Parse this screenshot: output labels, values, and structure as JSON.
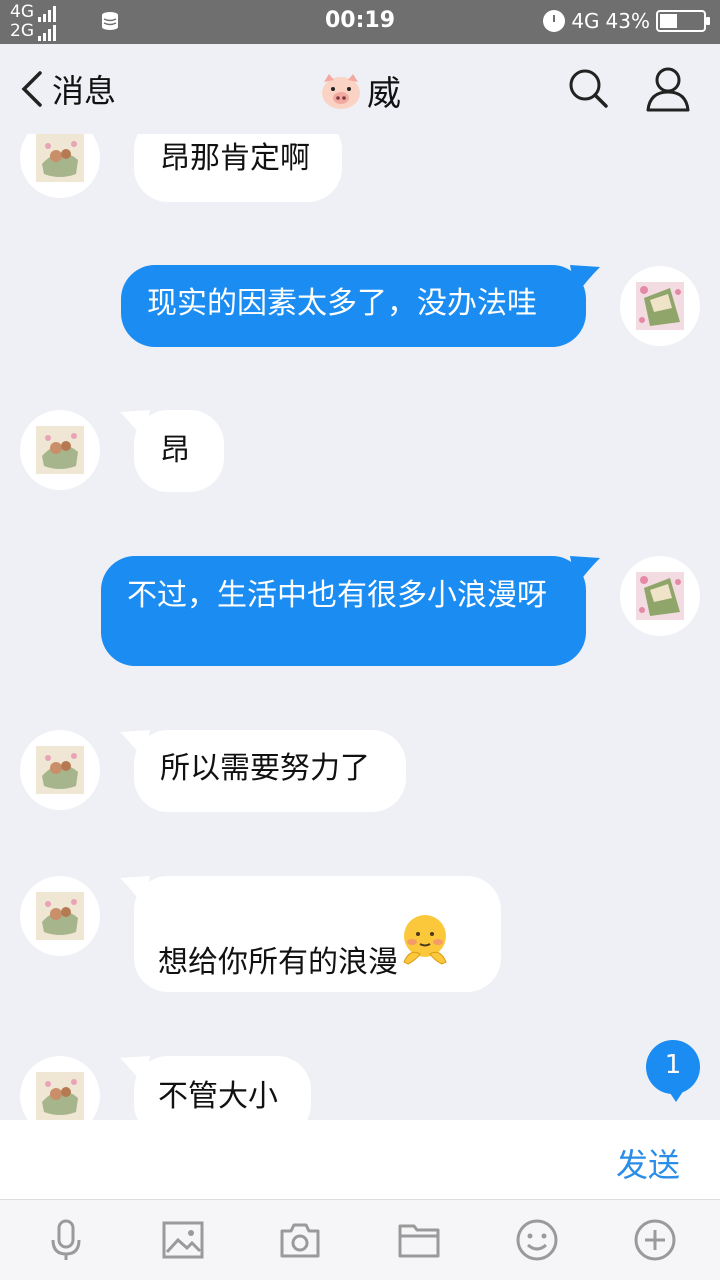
{
  "status_bar": {
    "net_top": "4G",
    "net_bottom": "2G",
    "time": "00:19",
    "net_right": "4G",
    "battery": "43%"
  },
  "header": {
    "back_label": "消息",
    "contact_name": "威"
  },
  "messages": [
    {
      "side": "in",
      "text": "昂那肯定啊"
    },
    {
      "side": "out",
      "text": "现实的因素太多了，没办法哇"
    },
    {
      "side": "in",
      "text": "昂"
    },
    {
      "side": "out",
      "text": "不过，生活中也有很多小浪漫呀"
    },
    {
      "side": "in",
      "text": "所以需要努力了"
    },
    {
      "side": "in",
      "text": "想给你所有的浪漫",
      "emoji": "blushing-face-emoji"
    },
    {
      "side": "in",
      "text": "不管大小"
    }
  ],
  "unread_count": "1",
  "input": {
    "value": "",
    "send_label": "发送"
  },
  "toolbar": [
    "microphone-icon",
    "image-icon",
    "camera-icon",
    "folder-icon",
    "emoji-icon",
    "plus-icon"
  ],
  "colors": {
    "outgoing_bubble": "#1b8cf2",
    "background": "#eef0f5",
    "send_text": "#2a8de8"
  }
}
